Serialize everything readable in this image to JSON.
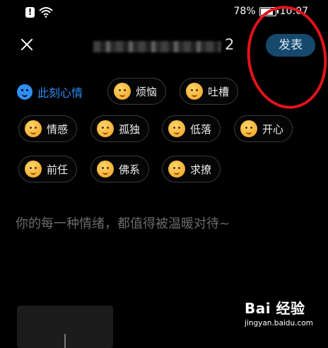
{
  "status": {
    "battery": "78%",
    "time": "10:07",
    "battery_level": 0.78
  },
  "header": {
    "title_suffix": "2",
    "publish_label": "发表"
  },
  "mood": {
    "title": "此刻心情",
    "chips": [
      "烦恼",
      "吐槽",
      "情感",
      "孤独",
      "低落",
      "开心",
      "前任",
      "佛系",
      "求撩"
    ]
  },
  "editor": {
    "placeholder": "你的每一种情绪，都值得被温暖对待~"
  },
  "watermark": {
    "brand": "Bai 经验",
    "url": "jingyan.baidu.com"
  },
  "colors": {
    "accent": "#2f8ef4",
    "publish_bg": "#17496e",
    "annotation": "#e3131b"
  }
}
